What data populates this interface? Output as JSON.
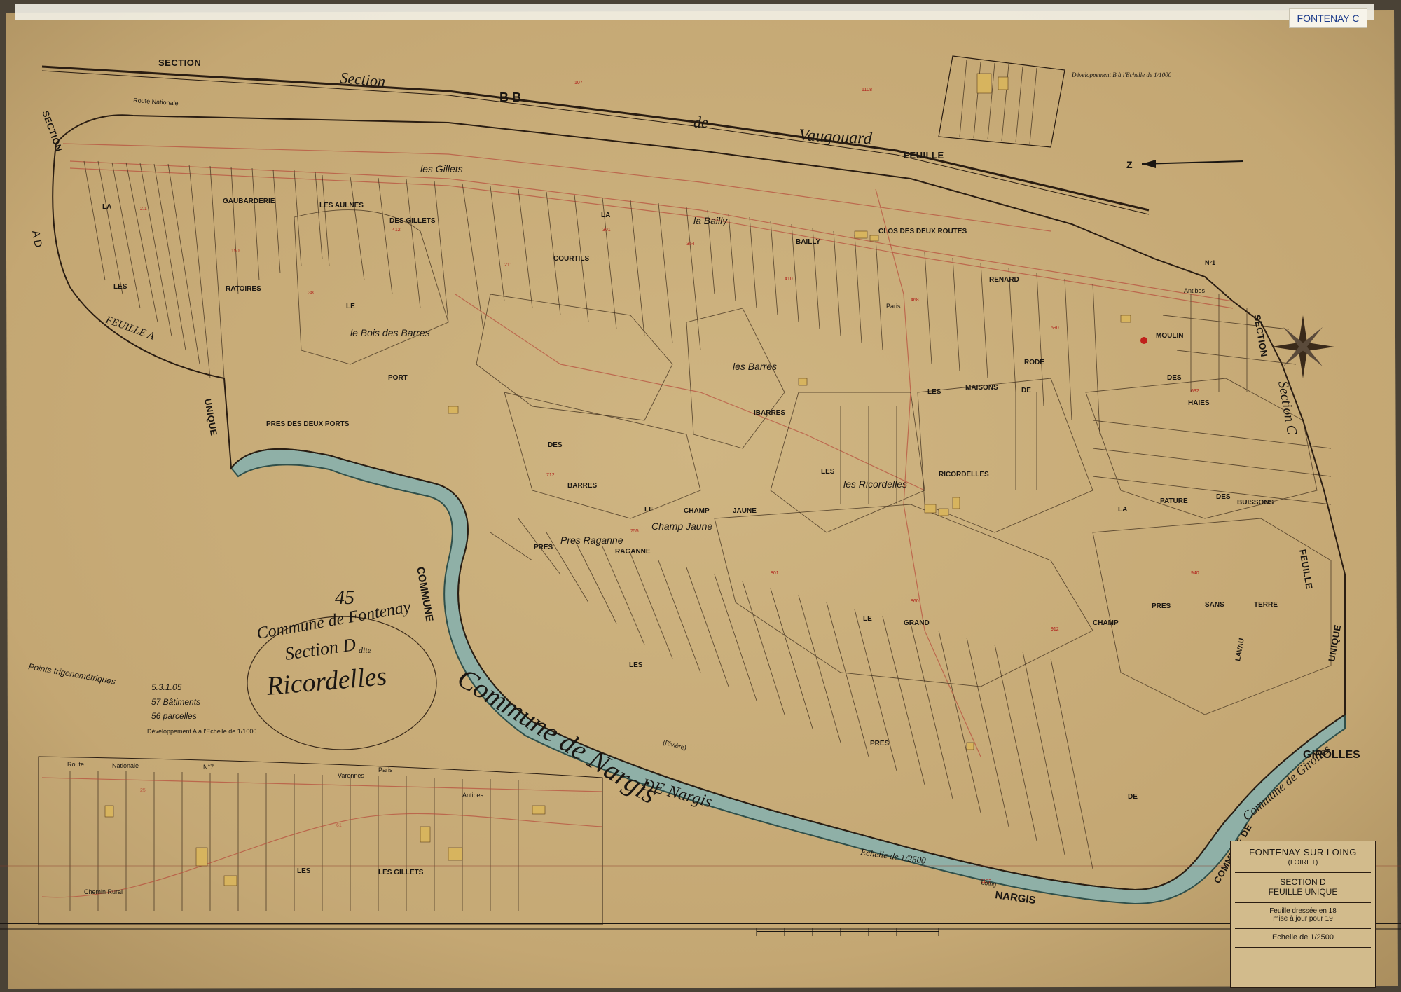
{
  "sheet": {
    "corner_tag": "FONTENAY C",
    "commune_big": "45",
    "cartouche": {
      "line1": "Commune de Fontenay",
      "line2": "Section D",
      "line2_sup": "dite",
      "line3": "Ricordelles"
    },
    "development_note": "Développement A à l'Echelle de 1/1000",
    "development_b": "Développement B à l'Echelle de 1/1000",
    "river_commune": "Commune de Nargis",
    "scale_label": "Echelle de 1/2500",
    "margin_notes": [
      "Points trigonométriques",
      "5.3.1.05",
      "57 Bâtiments",
      "56 parcelles"
    ]
  },
  "title_block": {
    "commune": "FONTENAY SUR LOING",
    "dept": "(LOIRET)",
    "section": "SECTION D",
    "sheet": "FEUILLE UNIQUE",
    "drawn": "Feuille dressée en 18",
    "updated": "mise à jour pour 19",
    "scale": "Echelle de 1/2500"
  },
  "neighbours": {
    "top_left": "SECTION",
    "top_section_script": "Section",
    "top_bb": "B  B",
    "top_de": "de",
    "top_vaugouard": "Vaugouard",
    "top_feuille": "FEUILLE",
    "left_section": "SECTION",
    "left_ad": "A D",
    "left_feuille": "FEUILLE A",
    "left_unique": "UNIQUE",
    "right_section": "SECTION",
    "right_section_c": "Section C",
    "right_feuille": "FEUILLE",
    "right_unique": "UNIQUE",
    "commune_vertical": "COMMUNE",
    "girolles": "GIROLLES",
    "commune_de_girolles": "Commune de Girolles",
    "de_nargis": "DE  Nargis",
    "nargis": "NARGIS",
    "commune_de": "COMMUNE DE"
  },
  "roads": {
    "route_nationale": "Route Nationale",
    "no1": "N°1",
    "paris": "Paris",
    "antibes": "Antibes",
    "route_bottom": "Route",
    "nationale_bottom": "Nationale",
    "no7": "N°7",
    "paris_bottom": "Paris",
    "antibes_bottom": "Antibes",
    "chemin_rural": "Chemin Rural",
    "rivière": "(Rivière)",
    "loing": "Loing",
    "varennes": "Varennes"
  },
  "places": [
    "GAUBARDERIE",
    "LES AULNES",
    "DES GILLETS",
    "LA",
    "LES",
    "RATOIRES",
    "LE",
    "PORT",
    "PRES DES DEUX PORTS",
    "COURTILS",
    "LA",
    "BAILLY",
    "CLOS DES DEUX ROUTES",
    "RENARD",
    "LES",
    "MAISONS",
    "DE",
    "RODE",
    "DES",
    "HAIES",
    "DES",
    "BARRES",
    "IBARRES",
    "LES",
    "RICORDELLES",
    "LA",
    "PATURE",
    "DES",
    "BUISSONS",
    "LE",
    "CHAMP",
    "JAUNE",
    "PRES",
    "RAGANNE",
    "LE",
    "GRAND",
    "CHAMP",
    "PRES",
    "SANS",
    "TERRE",
    "LES",
    "PRES",
    "DE",
    "LAVAU",
    "MOULIN",
    "LES GILLETS",
    "LES"
  ],
  "script_names": [
    "les Gillets",
    "la Bailly",
    "le Bois des Barres",
    "les Barres",
    "les Ricordelles",
    "Champ Jaune",
    "Pres Raganne"
  ],
  "north_arrow": "Z",
  "colors": {
    "paper": "#c9ad7a",
    "river": "#8fb0a7",
    "river_edge": "#2f4f4a",
    "ink": "#241a10",
    "red_ink": "#b0201a",
    "buildings": "#d7b45e"
  }
}
